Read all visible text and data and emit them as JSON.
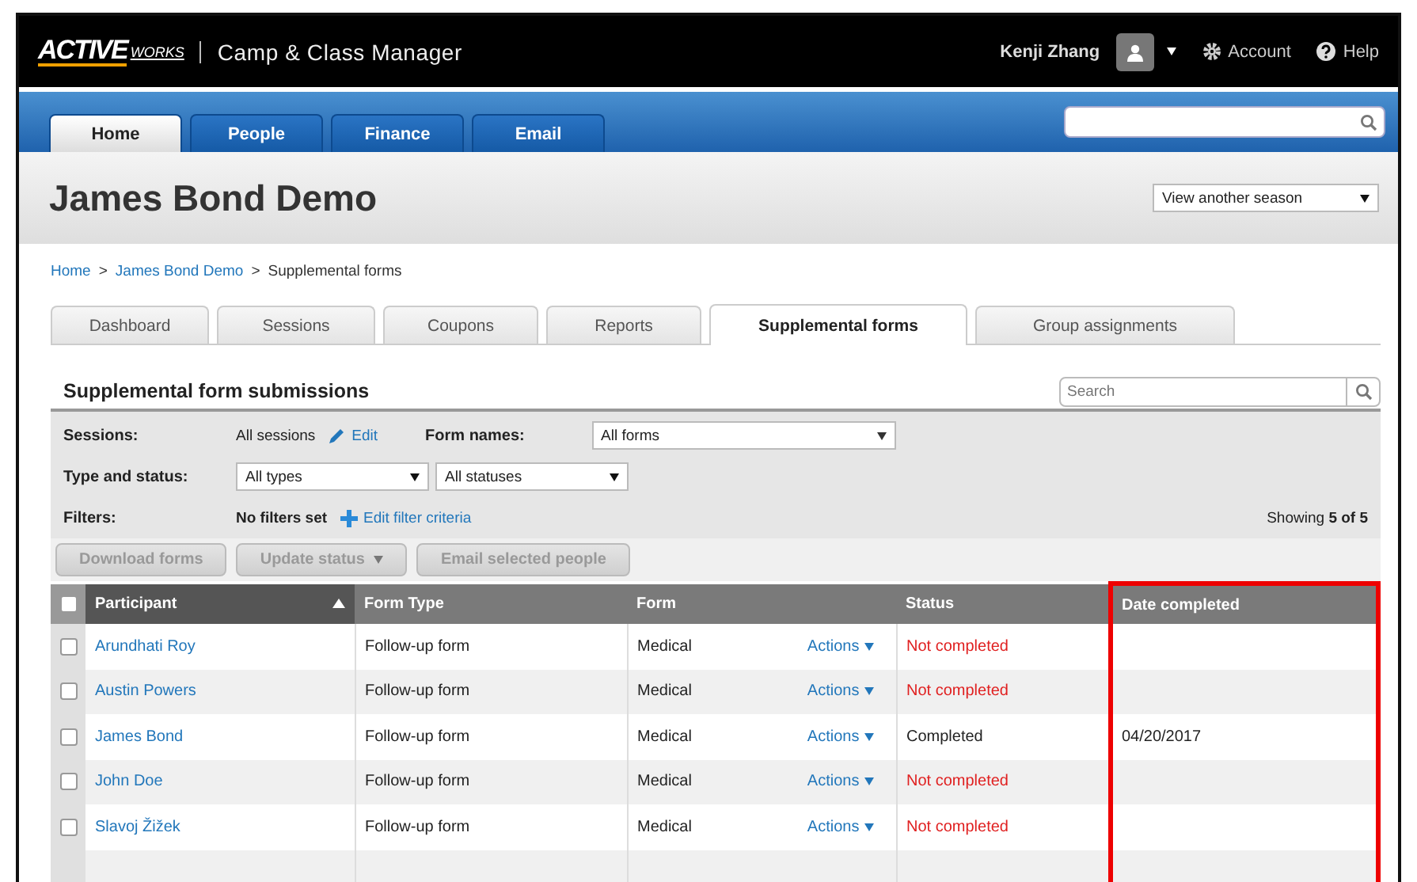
{
  "top_bar": {
    "logo": "ACTIVE",
    "logo_suffix": "WORKS",
    "app_name": "Camp & Class Manager",
    "user": "Kenji Zhang",
    "account": "Account",
    "help": "Help"
  },
  "nav": {
    "tabs": [
      {
        "label": "Home",
        "selected": true
      },
      {
        "label": "People",
        "selected": false
      },
      {
        "label": "Finance",
        "selected": false
      },
      {
        "label": "Email",
        "selected": false
      }
    ]
  },
  "page": {
    "title": "James Bond Demo",
    "season_select": "View another season"
  },
  "breadcrumb": [
    {
      "label": "Home",
      "kind": "link"
    },
    {
      "label": ">",
      "kind": "separator"
    },
    {
      "label": "James Bond Demo",
      "kind": "link"
    },
    {
      "label": ">",
      "kind": "separator"
    },
    {
      "label": "Supplemental forms",
      "kind": "current"
    }
  ],
  "sub_tabs": [
    {
      "label": "Dashboard",
      "selected": false
    },
    {
      "label": "Sessions",
      "selected": false
    },
    {
      "label": "Coupons",
      "selected": false
    },
    {
      "label": "Reports",
      "selected": false
    },
    {
      "label": "Supplemental forms",
      "selected": true
    },
    {
      "label": "Group assignments",
      "selected": false
    }
  ],
  "panel": {
    "title": "Supplemental form submissions",
    "search": {
      "placeholder": "Search"
    },
    "filters": {
      "sessions_label": "Sessions:",
      "sessions_value": "All sessions",
      "edit_link": "Edit",
      "form_names_label": "Form names:",
      "form_names_value": "All forms",
      "type_status_label": "Type and status:",
      "type_value": "All types",
      "status_value": "All statuses",
      "filters_label": "Filters:",
      "filters_value": "No filters set",
      "edit_filter_link": "Edit filter criteria",
      "showing": "Showing **5 of 5**"
    },
    "buttons": [
      {
        "label": "Download forms",
        "disabled": true,
        "kind": "plain"
      },
      {
        "label": "Update status",
        "disabled": true,
        "kind": "dropdown"
      },
      {
        "label": "Email selected people",
        "disabled": true,
        "kind": "plain"
      }
    ]
  },
  "table": {
    "header_checkbox": {
      "checked": false
    },
    "columns": [
      {
        "label": "Participant",
        "sorted": true,
        "highlighted": false
      },
      {
        "label": "Form Type",
        "sorted": false,
        "highlighted": false
      },
      {
        "label": "Form",
        "sorted": false,
        "highlighted": false
      },
      {
        "label": "Status",
        "sorted": false,
        "highlighted": false
      },
      {
        "label": "Date completed",
        "sorted": false,
        "highlighted": true
      }
    ],
    "rows": [
      {
        "checked": false,
        "participant": "Arundhati Roy",
        "form_type": "Follow-up form",
        "form": "Medical",
        "actions": "Actions",
        "status": "Not completed",
        "completed": false
      },
      {
        "checked": false,
        "participant": "Austin Powers",
        "form_type": "Follow-up form",
        "form": "Medical",
        "actions": "Actions",
        "status": "Not completed",
        "completed": false
      },
      {
        "checked": false,
        "participant": "James Bond",
        "form_type": "Follow-up form",
        "form": "Medical",
        "actions": "Actions",
        "status": "Completed",
        "completed": true,
        "date_completed": "04/20/2017"
      },
      {
        "checked": false,
        "participant": "John Doe",
        "form_type": "Follow-up form",
        "form": "Medical",
        "actions": "Actions",
        "status": "Not completed",
        "completed": false
      },
      {
        "checked": false,
        "participant": "Slavoj Žižek",
        "form_type": "Follow-up form",
        "form": "Medical",
        "actions": "Actions",
        "status": "Not completed",
        "completed": false
      }
    ]
  }
}
